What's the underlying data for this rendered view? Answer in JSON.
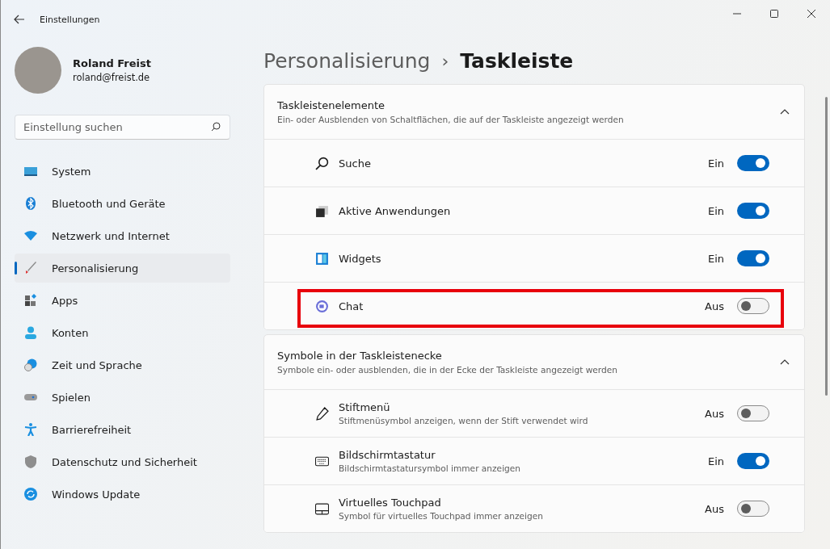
{
  "window": {
    "title": "Einstellungen"
  },
  "user": {
    "name": "Roland Freist",
    "email": "roland@freist.de"
  },
  "search": {
    "placeholder": "Einstellung suchen"
  },
  "sidebar": {
    "items": [
      {
        "label": "System",
        "kind": "system",
        "selected": false
      },
      {
        "label": "Bluetooth und Geräte",
        "kind": "bluetooth",
        "selected": false
      },
      {
        "label": "Netzwerk und Internet",
        "kind": "network",
        "selected": false
      },
      {
        "label": "Personalisierung",
        "kind": "brush",
        "selected": true
      },
      {
        "label": "Apps",
        "kind": "apps",
        "selected": false
      },
      {
        "label": "Konten",
        "kind": "account",
        "selected": false
      },
      {
        "label": "Zeit und Sprache",
        "kind": "time",
        "selected": false
      },
      {
        "label": "Spielen",
        "kind": "gaming",
        "selected": false
      },
      {
        "label": "Barrierefreiheit",
        "kind": "accessibility",
        "selected": false
      },
      {
        "label": "Datenschutz und Sicherheit",
        "kind": "shield",
        "selected": false
      },
      {
        "label": "Windows Update",
        "kind": "update",
        "selected": false
      }
    ]
  },
  "breadcrumb": {
    "parent": "Personalisierung",
    "separator": "›",
    "current": "Taskleiste"
  },
  "sections": [
    {
      "title": "Taskleistenelemente",
      "subtitle": "Ein- oder Ausblenden von Schaltflächen, die auf der Taskleiste angezeigt werden",
      "expanded": true,
      "items": [
        {
          "label": "Suche",
          "kind": "search",
          "on": true,
          "state": "Ein",
          "highlighted": false
        },
        {
          "label": "Aktive Anwendungen",
          "kind": "taskview",
          "on": true,
          "state": "Ein",
          "highlighted": false
        },
        {
          "label": "Widgets",
          "kind": "widgets",
          "on": true,
          "state": "Ein",
          "highlighted": false
        },
        {
          "label": "Chat",
          "kind": "chat",
          "on": false,
          "state": "Aus",
          "highlighted": true
        }
      ]
    },
    {
      "title": "Symbole in der Taskleistenecke",
      "subtitle": "Symbole ein- oder ausblenden, die in der Ecke der Taskleiste angezeigt werden",
      "expanded": true,
      "items": [
        {
          "label": "Stiftmenü",
          "description": "Stiftmenüsymbol anzeigen, wenn der Stift verwendet wird",
          "kind": "pen",
          "on": false,
          "state": "Aus",
          "highlighted": false
        },
        {
          "label": "Bildschirmtastatur",
          "description": "Bildschirmtastatursymbol immer anzeigen",
          "kind": "keyboard",
          "on": true,
          "state": "Ein",
          "highlighted": false
        },
        {
          "label": "Virtuelles Touchpad",
          "description": "Symbol für virtuelles Touchpad immer anzeigen",
          "kind": "touchpad",
          "on": false,
          "state": "Aus",
          "highlighted": false
        }
      ]
    }
  ]
}
